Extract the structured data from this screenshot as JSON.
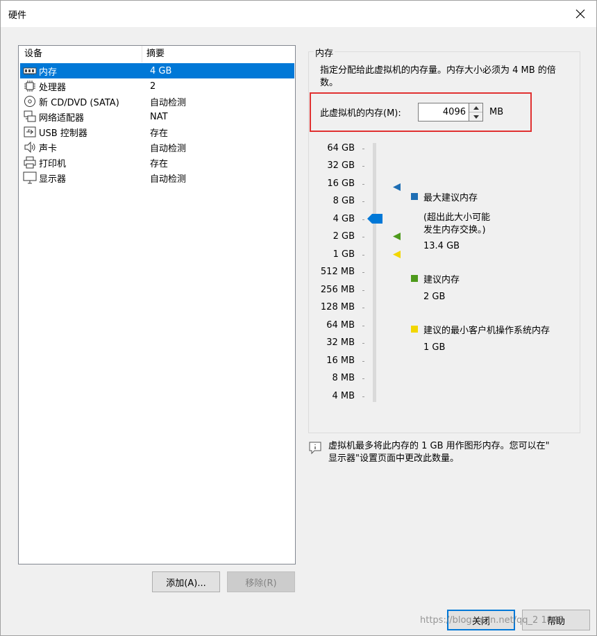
{
  "window": {
    "title": "硬件"
  },
  "device_list": {
    "headers": [
      "设备",
      "摘要"
    ],
    "rows": [
      {
        "name": "内存",
        "summary": "4 GB",
        "icon": "memory-icon",
        "selected": true
      },
      {
        "name": "处理器",
        "summary": "2",
        "icon": "processor-icon",
        "selected": false
      },
      {
        "name": "新 CD/DVD (SATA)",
        "summary": "自动检测",
        "icon": "cd-dvd-icon",
        "selected": false
      },
      {
        "name": "网络适配器",
        "summary": "NAT",
        "icon": "network-adapter-icon",
        "selected": false
      },
      {
        "name": "USB 控制器",
        "summary": "存在",
        "icon": "usb-icon",
        "selected": false
      },
      {
        "name": "声卡",
        "summary": "自动检测",
        "icon": "speaker-icon",
        "selected": false
      },
      {
        "name": "打印机",
        "summary": "存在",
        "icon": "printer-icon",
        "selected": false
      },
      {
        "name": "显示器",
        "summary": "自动检测",
        "icon": "monitor-icon",
        "selected": false
      }
    ]
  },
  "buttons": {
    "add": "添加(A)...",
    "remove": "移除(R)",
    "close": "关闭",
    "help": "帮助"
  },
  "memory": {
    "group_title": "内存",
    "description": "指定分配给此虚拟机的内存量。内存大小必须为 4 MB 的倍数。",
    "field_label": "此虚拟机的内存(M):",
    "value": "4096",
    "unit": "MB",
    "scale_labels": [
      "64 GB",
      "32 GB",
      "16 GB",
      "8 GB",
      "4 GB",
      "2 GB",
      "1 GB",
      "512 MB",
      "256 MB",
      "128 MB",
      "64 MB",
      "32 MB",
      "16 MB",
      "8 MB",
      "4 MB"
    ],
    "slider_value": "4 GB",
    "legend": {
      "max_title": "最大建议内存",
      "max_note_1": "(超出此大小可能",
      "max_note_2": "发生内存交换。)",
      "max_value": "13.4 GB",
      "rec_title": "建议内存",
      "rec_value": "2 GB",
      "min_title": "建议的最小客户机操作系统内存",
      "min_value": "1 GB"
    },
    "colors": {
      "max": "#1e6eb4",
      "recommended": "#4e9a1c",
      "minimum": "#f2d600",
      "thumb": "#0078d7"
    }
  },
  "info": {
    "line1": "虚拟机最多将此内存的 1 GB 用作图形内存。您可以在\"",
    "line2": "显示器\"设置页面中更改此数量。"
  },
  "watermark": "https://blog.csdn.net/qq_2        1843"
}
